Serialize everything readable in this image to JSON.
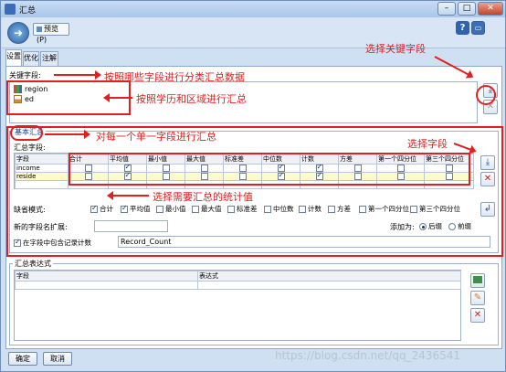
{
  "window": {
    "title": "汇总",
    "preview_label": "预览(P)",
    "colors": {
      "accent": "#3a6cb8",
      "annotation": "#e02020"
    }
  },
  "tabs": [
    {
      "label": "设置",
      "active": true
    },
    {
      "label": "优化",
      "active": false
    },
    {
      "label": "注解",
      "active": false
    }
  ],
  "key_fields": {
    "label": "关键字段:",
    "items": [
      {
        "name": "region",
        "icon": "nominal-field-icon"
      },
      {
        "name": "ed",
        "icon": "continuous-field-icon"
      }
    ]
  },
  "basic_aggregation": {
    "title": "基本汇总",
    "fields_label": "汇总字段:",
    "columns": [
      "字段",
      "合计",
      "平均值",
      "最小值",
      "最大值",
      "标准差",
      "中位数",
      "计数",
      "方差",
      "第一个四分位",
      "第三个四分位"
    ],
    "rows": [
      {
        "field": "income",
        "checks": [
          false,
          true,
          false,
          false,
          false,
          true,
          true,
          false,
          false,
          false
        ],
        "selected": false
      },
      {
        "field": "reside",
        "checks": [
          false,
          true,
          false,
          false,
          false,
          true,
          true,
          false,
          false,
          false
        ],
        "selected": true
      }
    ],
    "default_mode_label": "缺省模式:",
    "default_modes": [
      {
        "label": "合计",
        "checked": true
      },
      {
        "label": "平均值",
        "checked": true
      },
      {
        "label": "最小值",
        "checked": false
      },
      {
        "label": "最大值",
        "checked": false
      },
      {
        "label": "标准差",
        "checked": false
      },
      {
        "label": "中位数",
        "checked": false
      },
      {
        "label": "计数",
        "checked": false
      },
      {
        "label": "方差",
        "checked": false
      },
      {
        "label": "第一个四分位",
        "checked": false
      },
      {
        "label": "第三个四分位",
        "checked": false
      }
    ],
    "extension_label": "新的字段名扩展:",
    "extension_value": "",
    "add_to_label": "添加为:",
    "add_to_options": [
      {
        "label": "后缀",
        "selected": true
      },
      {
        "label": "前缀",
        "selected": false
      }
    ],
    "include_count_label": "在字段中包含记录计数",
    "include_count_checked": true,
    "record_count_value": "Record_Count"
  },
  "aggregation_expressions": {
    "title": "汇总表达式",
    "columns": [
      "字段",
      "表达式"
    ]
  },
  "buttons": {
    "ok": "确定",
    "cancel": "取消"
  },
  "annotations": {
    "select_key_field": "选择关键字段",
    "group_by_fields": "按照哪些字段进行分类汇总数据",
    "group_by_education_region": "按照学历和区域进行汇总",
    "summarize_each_field": "对每一个单一字段进行汇总",
    "select_field": "选择字段",
    "select_statistics": "选择需要汇总的统计值"
  },
  "watermark": "https://blog.csdn.net/qq_2436541"
}
